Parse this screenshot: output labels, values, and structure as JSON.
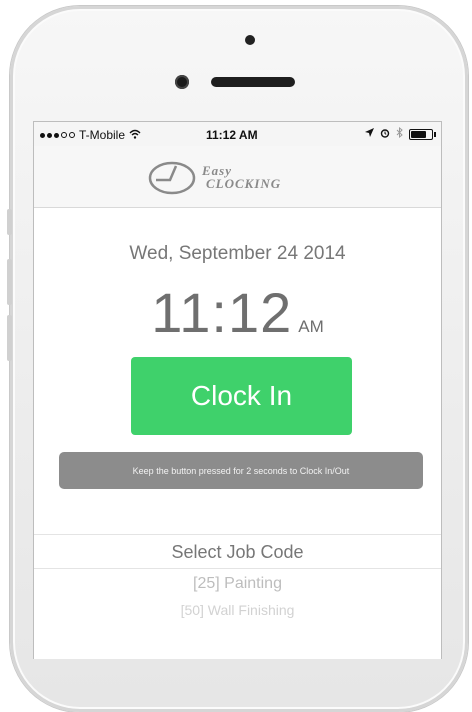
{
  "status_bar": {
    "carrier": "T-Mobile",
    "time": "11:12 AM",
    "battery_level": 0.75
  },
  "app": {
    "logo_line1": "Easy",
    "logo_line2": "Clocking"
  },
  "main": {
    "date": "Wed, September 24 2014",
    "time": "11:12",
    "ampm": "AM",
    "clock_button_label": "Clock In",
    "hint": "Keep the button pressed for 2 seconds to Clock In/Out",
    "picker_label": "Select Job Code",
    "job_codes": [
      "[25] Painting",
      "[50] Wall Finishing"
    ]
  },
  "colors": {
    "accent": "#3fd16b",
    "hint_bg": "#8c8c8c"
  },
  "icons": [
    "wifi-icon",
    "location-arrow-icon",
    "alarm-icon",
    "bluetooth-icon",
    "battery-icon",
    "clock-logo-icon"
  ]
}
